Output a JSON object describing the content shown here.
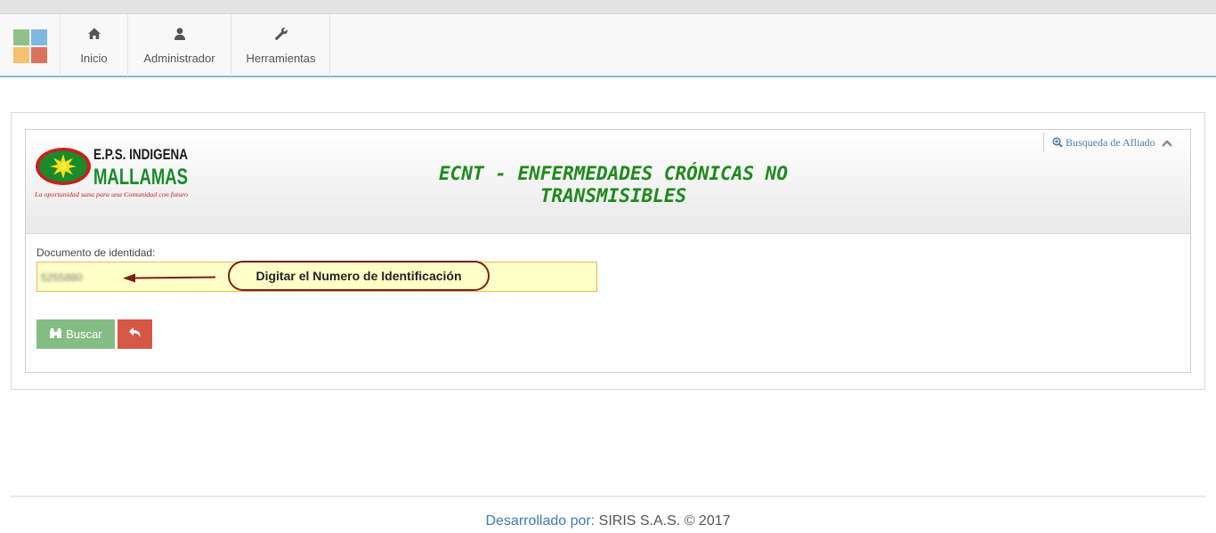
{
  "navbar": {
    "items": [
      {
        "label": "Inicio",
        "icon": "home-icon"
      },
      {
        "label": "Administrador",
        "icon": "user-icon"
      },
      {
        "label": "Herramientas",
        "icon": "wrench-icon"
      }
    ],
    "brand_colors": [
      "#8fc18a",
      "#7fb8e3",
      "#f7c06d",
      "#d9735e"
    ]
  },
  "panel": {
    "logo": {
      "line1": "E.P.S. INDIGENA",
      "line2": "MALLAMAS",
      "tagline": "La oportunidad sana para una Comunidad con futuro"
    },
    "title_line1": "ECNT - ENFERMEDADES CRÓNICAS NO",
    "title_line2": "TRANSMISIBLES",
    "search_link": "Busqueda de Afliado",
    "search_link_icon": "zoom-in-icon",
    "collapse_icon": "chevron-up-icon"
  },
  "form": {
    "label": "Documento de identidad:",
    "value": "5255880",
    "callout": "Digitar el Numero de Identificación",
    "buscar_label": "Buscar",
    "buscar_icon": "binoculars-icon",
    "back_icon": "undo-arrow-icon"
  },
  "footer": {
    "developed_by": "Desarrollado por:",
    "company": "SIRIS S.A.S. © 2017"
  },
  "colors": {
    "title_green": "#1e8a1c",
    "accent_blue": "#3f7ab7",
    "buscar_button": "#84bd84",
    "back_button": "#d45845",
    "input_bg": "#ffffc7",
    "callout_border": "#7a1f1f"
  }
}
